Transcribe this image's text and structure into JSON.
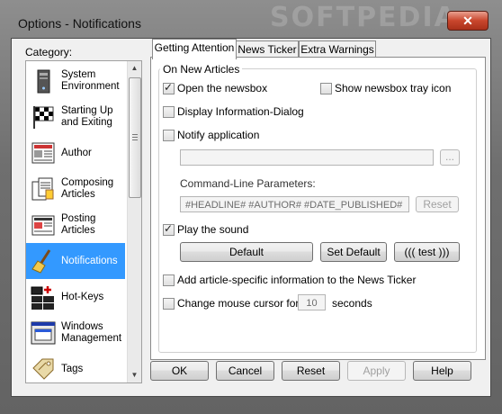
{
  "window": {
    "title": "Options - Notifications",
    "watermark": "SOFTPEDIA"
  },
  "category": {
    "label": "Category:",
    "items": [
      {
        "label": "System Environment",
        "icon": "computer-tower-icon"
      },
      {
        "label": "Starting Up and Exiting",
        "icon": "checkered-flag-icon"
      },
      {
        "label": "Author",
        "icon": "newspaper-icon"
      },
      {
        "label": "Composing Articles",
        "icon": "documents-icon"
      },
      {
        "label": "Posting Articles",
        "icon": "newspaper-post-icon"
      },
      {
        "label": "Notifications",
        "icon": "broom-icon",
        "selected": true
      },
      {
        "label": "Hot-Keys",
        "icon": "keyboard-keys-icon"
      },
      {
        "label": "Windows Management",
        "icon": "windows-icon"
      },
      {
        "label": "Tags",
        "icon": "tag-icon"
      }
    ]
  },
  "tabs": [
    "Getting Attention",
    "News Ticker",
    "Extra Warnings"
  ],
  "panel": {
    "group_title": "On New Articles",
    "open_newsbox": {
      "label": "Open the newsbox",
      "checked": true
    },
    "show_tray_icon": {
      "label": "Show newsbox tray icon",
      "checked": false
    },
    "display_info_dialog": {
      "label": "Display Information-Dialog",
      "checked": false
    },
    "notify_application": {
      "label": "Notify application",
      "checked": false
    },
    "app_path": {
      "value": ""
    },
    "browse_label": "...",
    "cmdline_label": "Command-Line Parameters:",
    "cmdline_value": "#HEADLINE# #AUTHOR# #DATE_PUBLISHED#",
    "reset_label": "Reset",
    "play_sound": {
      "label": "Play the sound",
      "checked": true
    },
    "sound_default": "Default",
    "set_default": "Set Default",
    "test": "((( test )))",
    "add_article_info": {
      "label": "Add article-specific information to the News Ticker",
      "checked": false
    },
    "change_cursor": {
      "label": "Change mouse cursor for",
      "checked": false
    },
    "cursor_seconds": "10",
    "seconds_label": "seconds"
  },
  "buttons": {
    "ok": "OK",
    "cancel": "Cancel",
    "reset": "Reset",
    "apply": "Apply",
    "help": "Help"
  }
}
